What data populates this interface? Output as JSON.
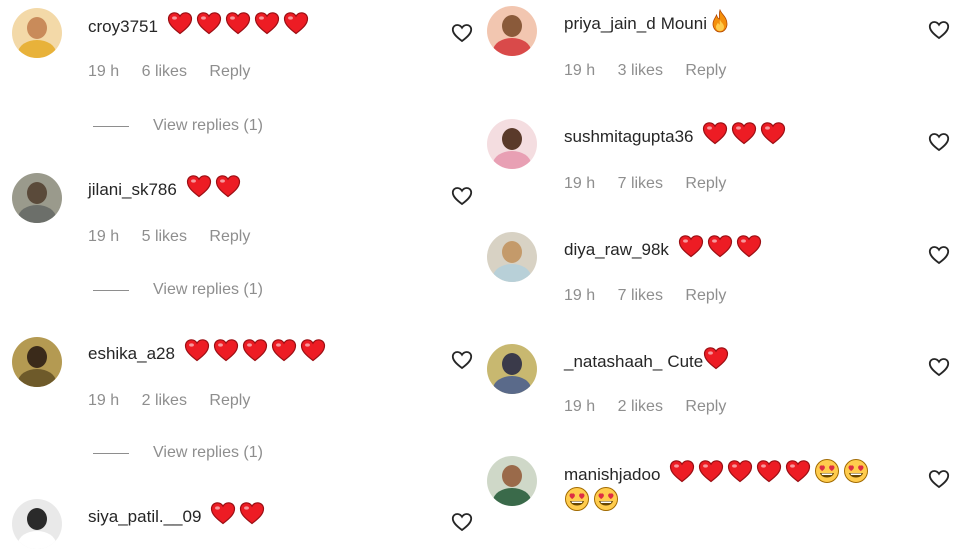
{
  "colors": {
    "text": "#262626",
    "muted": "#8e8e8e",
    "heart": "#ed1c24"
  },
  "comments_left": [
    {
      "username": "croy3751",
      "text": "",
      "hearts": 5,
      "time": "19 h",
      "likes": "6 likes",
      "reply": "Reply",
      "view_replies": "View replies (1)"
    },
    {
      "username": "jilani_sk786",
      "text": "",
      "hearts": 2,
      "time": "19 h",
      "likes": "5 likes",
      "reply": "Reply",
      "view_replies": "View replies (1)"
    },
    {
      "username": "eshika_a28",
      "text": "",
      "hearts": 5,
      "time": "19 h",
      "likes": "2 likes",
      "reply": "Reply",
      "view_replies": "View replies (1)"
    },
    {
      "username": "siya_patil.__09",
      "text": "",
      "hearts": 2
    }
  ],
  "comments_right": [
    {
      "username": "priya_jain_d",
      "text": "Mouni",
      "emoji": "fire-icon",
      "time": "19 h",
      "likes": "3 likes",
      "reply": "Reply"
    },
    {
      "username": "sushmitagupta36",
      "text": "",
      "hearts": 3,
      "time": "19 h",
      "likes": "7 likes",
      "reply": "Reply"
    },
    {
      "username": "diya_raw_98k",
      "text": "",
      "hearts": 3,
      "time": "19 h",
      "likes": "7 likes",
      "reply": "Reply"
    },
    {
      "username": "_natashaah_",
      "text": "Cute",
      "hearts": 1,
      "time": "19 h",
      "likes": "2 likes",
      "reply": "Reply"
    },
    {
      "username": "manishjadoo",
      "text": "",
      "hearts": 5,
      "star_eyes": 4
    }
  ]
}
